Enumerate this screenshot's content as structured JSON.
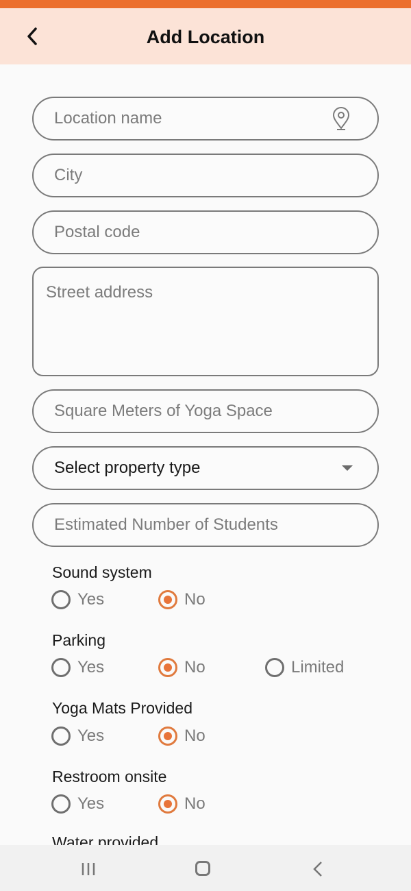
{
  "header": {
    "title": "Add Location",
    "back_icon": "chevron-left-icon"
  },
  "fields": {
    "location_name": {
      "placeholder": "Location name",
      "icon": "map-pin-icon"
    },
    "city": {
      "placeholder": "City"
    },
    "postal_code": {
      "placeholder": "Postal code"
    },
    "street_address": {
      "placeholder": "Street address"
    },
    "square_meters": {
      "placeholder": "Square Meters of Yoga Space"
    },
    "property_type": {
      "selected": "Select property type"
    },
    "students": {
      "placeholder": "Estimated Number of Students"
    }
  },
  "questions": [
    {
      "label": "Sound system",
      "options": [
        "Yes",
        "No"
      ],
      "selected": "No"
    },
    {
      "label": "Parking",
      "options": [
        "Yes",
        "No",
        "Limited"
      ],
      "selected": "No"
    },
    {
      "label": "Yoga Mats Provided",
      "options": [
        "Yes",
        "No"
      ],
      "selected": "No"
    },
    {
      "label": "Restroom onsite",
      "options": [
        "Yes",
        "No"
      ],
      "selected": "No"
    },
    {
      "label": "Water provided"
    }
  ],
  "colors": {
    "accent": "#e8743a",
    "header_bg": "#fce3d7",
    "status_bar": "#ec6f2d"
  }
}
